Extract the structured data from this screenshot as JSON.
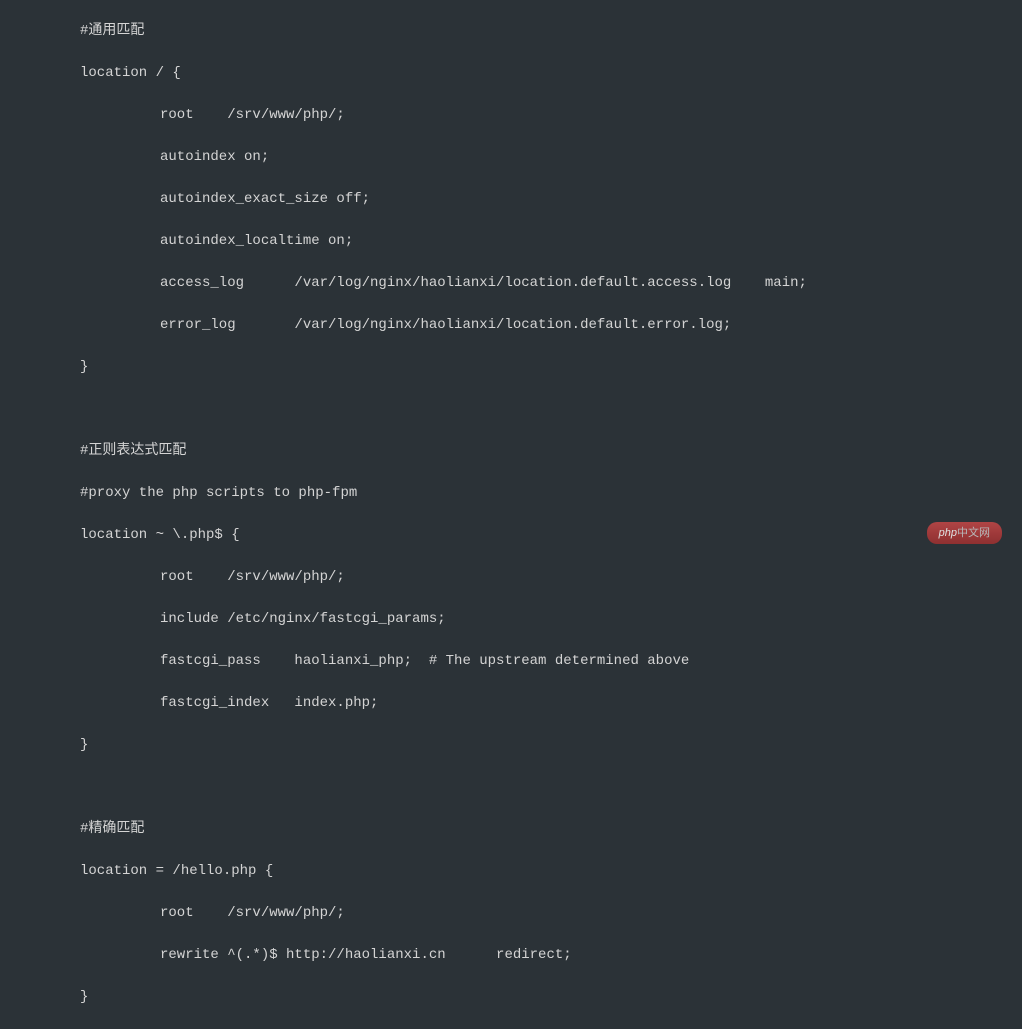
{
  "block1": {
    "comment": "#通用匹配",
    "location_open": "location / {",
    "line_root": "root    /srv/www/php/;",
    "line_autoindex": "autoindex on;",
    "line_exact_size": "autoindex_exact_size off;",
    "line_localtime": "autoindex_localtime on;",
    "line_access_log": "access_log      /var/log/nginx/haolianxi/location.default.access.log    main;",
    "line_error_log": "error_log       /var/log/nginx/haolianxi/location.default.error.log;",
    "close": "}"
  },
  "block2": {
    "comment1": "#正则表达式匹配",
    "comment2": "#proxy the php scripts to php-fpm",
    "location_open": "location ~ \\.php$ {",
    "line_root": "root    /srv/www/php/;",
    "line_include": "include /etc/nginx/fastcgi_params;",
    "line_fastcgi_pass": "fastcgi_pass    haolianxi_php;  # The upstream determined above",
    "line_fastcgi_index": "fastcgi_index   index.php;",
    "close": "}"
  },
  "block3": {
    "comment": "#精确匹配",
    "location_open": "location = /hello.php {",
    "line_root": "root    /srv/www/php/;",
    "line_rewrite": "rewrite ^(.*)$ http://haolianxi.cn      redirect;",
    "close": "}"
  },
  "watermark": {
    "main": "php",
    "suffix": "中文网"
  }
}
